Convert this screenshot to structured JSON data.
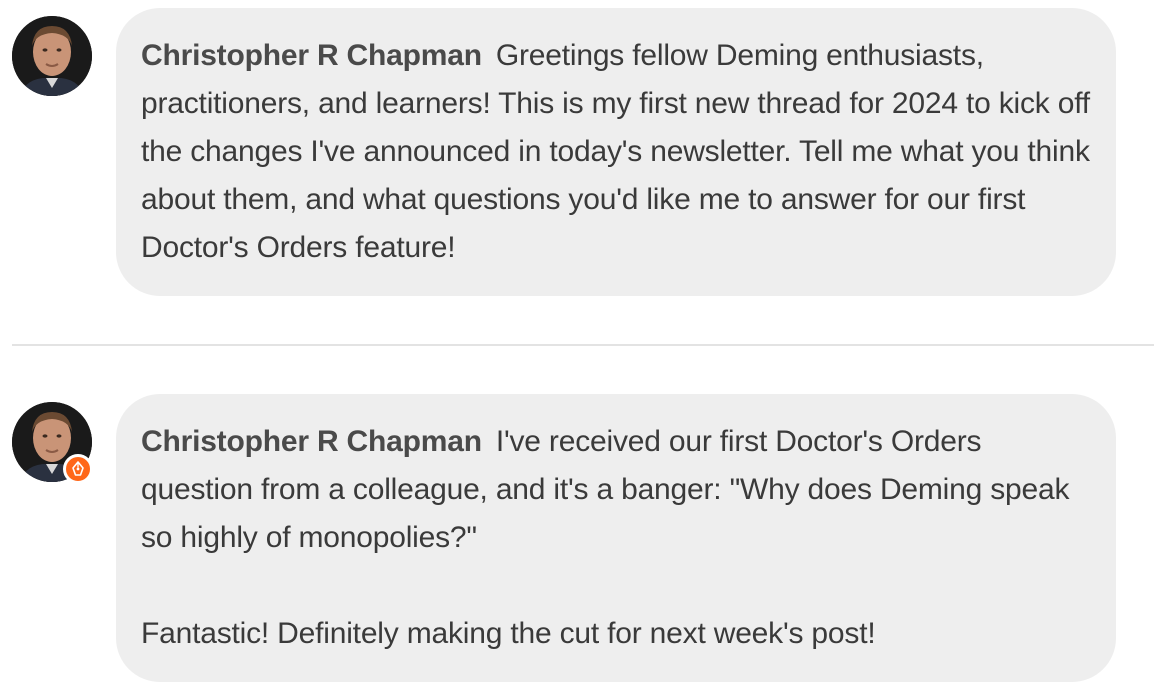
{
  "thread": {
    "comments": [
      {
        "author": "Christopher R Chapman",
        "paragraphs": [
          "Greetings fellow Deming enthusiasts, practitioners, and learners! This is my first new thread for 2024 to kick off the changes I've announced in today's newsletter. Tell me what you think about them, and what questions you'd like me to an­swer for our first Doctor's Orders feature!"
        ],
        "has_author_badge": false
      },
      {
        "author": "Christopher R Chapman",
        "paragraphs": [
          "I've received our first Doctor's Orders question from a colleague, and it's a banger: \"Why does Deming speak so highly of monopolies?\"",
          "Fantastic! Definitely making the cut for next week's post!"
        ],
        "has_author_badge": true
      }
    ]
  },
  "colors": {
    "bubble_bg": "#eeeeee",
    "badge_orange": "#ff6719",
    "text": "#3a3a3a",
    "divider": "#e3e3e3"
  },
  "icons": {
    "avatar": "author-photo",
    "badge": "pen-nib-icon"
  }
}
